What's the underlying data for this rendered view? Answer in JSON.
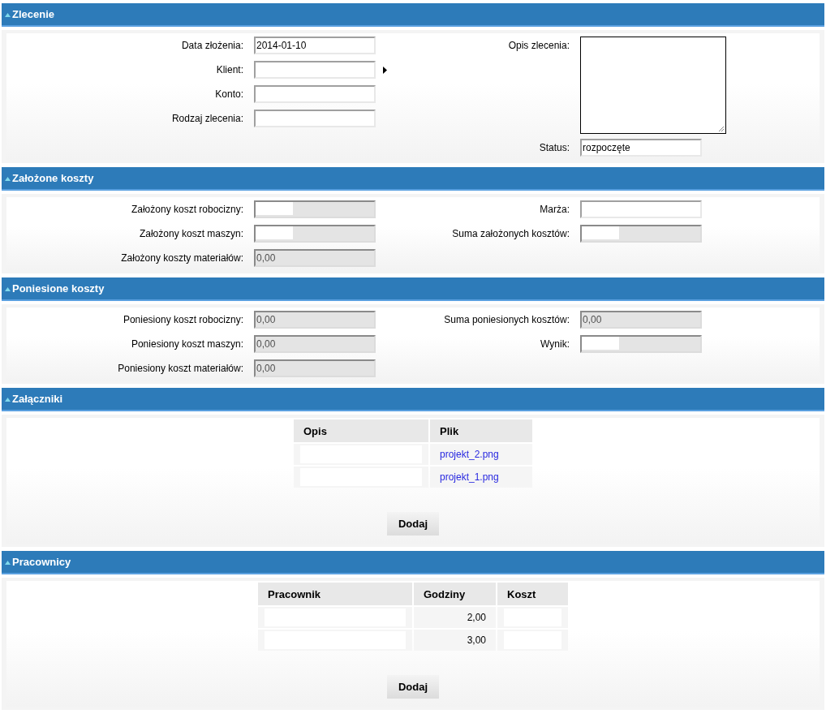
{
  "sections": [
    {
      "title": "Zlecenie",
      "kind": "form",
      "expanded": true,
      "left": [
        {
          "label": "Data złożenia:",
          "value": "2014-01-10",
          "kind": "text",
          "disabled": false
        },
        {
          "label": "Klient:",
          "kind": "lookup",
          "disabled": false
        },
        {
          "label": "Konto:",
          "kind": "text",
          "disabled": false
        },
        {
          "label": "Rodzaj zlecenia:",
          "kind": "text",
          "disabled": false
        }
      ],
      "right": [
        {
          "label": "Opis zlecenia:",
          "kind": "textarea",
          "disabled": false
        },
        {
          "label": "Status:",
          "value": "rozpoczęte",
          "kind": "text",
          "disabled": false
        }
      ]
    },
    {
      "title": "Założone koszty",
      "kind": "form",
      "expanded": true,
      "left": [
        {
          "label": "Założony koszt robocizny:",
          "kind": "masked",
          "disabled": true
        },
        {
          "label": "Założony koszt maszyn:",
          "kind": "masked",
          "disabled": true
        },
        {
          "label": "Założony koszty materiałów:",
          "value": "0,00",
          "kind": "text",
          "disabled": true
        }
      ],
      "right": [
        {
          "label": "Marża:",
          "kind": "text",
          "disabled": false
        },
        {
          "label": "Suma założonych kosztów:",
          "kind": "masked",
          "disabled": true
        }
      ]
    },
    {
      "title": "Poniesione koszty",
      "kind": "form",
      "expanded": true,
      "left": [
        {
          "label": "Poniesiony koszt robocizny:",
          "value": "0,00",
          "kind": "text",
          "disabled": true
        },
        {
          "label": "Poniesiony koszt maszyn:",
          "value": "0,00",
          "kind": "text",
          "disabled": true
        },
        {
          "label": "Poniesiony koszt materiałów:",
          "value": "0,00",
          "kind": "text",
          "disabled": true
        }
      ],
      "right": [
        {
          "label": "Suma poniesionych kosztów:",
          "value": "0,00",
          "kind": "text",
          "disabled": true
        },
        {
          "label": "Wynik:",
          "kind": "masked",
          "disabled": true
        }
      ]
    },
    {
      "title": "Załączniki",
      "kind": "table",
      "expanded": true,
      "columns": [
        "Opis",
        "Plik"
      ],
      "rows": [
        [
          {
            "kind": "redacted"
          },
          {
            "kind": "link",
            "text": "projekt_2.png"
          }
        ],
        [
          {
            "kind": "redacted"
          },
          {
            "kind": "link",
            "text": "projekt_1.png"
          }
        ]
      ],
      "button": "Dodaj"
    },
    {
      "title": "Pracownicy",
      "kind": "table",
      "expanded": true,
      "columns": [
        "Pracownik",
        "Godziny",
        "Koszt"
      ],
      "rows": [
        [
          {
            "kind": "redacted"
          },
          {
            "kind": "number",
            "text": "2,00"
          },
          {
            "kind": "redacted"
          }
        ],
        [
          {
            "kind": "redacted"
          },
          {
            "kind": "number",
            "text": "3,00"
          },
          {
            "kind": "redacted"
          }
        ]
      ],
      "button": "Dodaj"
    }
  ]
}
